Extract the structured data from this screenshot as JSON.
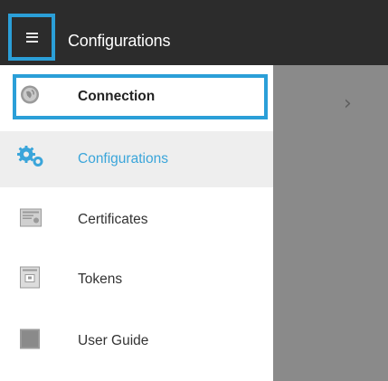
{
  "appbar": {
    "title": "Configurations",
    "menu_icon": "hamburger-menu-icon"
  },
  "drawer": {
    "items": [
      {
        "label": "Connection",
        "icon": "globe-icon",
        "state": "focused"
      },
      {
        "label": "Configurations",
        "icon": "gears-icon",
        "state": "selected"
      },
      {
        "label": "Certificates",
        "icon": "certificate-icon",
        "state": "normal"
      },
      {
        "label": "Tokens",
        "icon": "token-icon",
        "state": "normal"
      },
      {
        "label": "User Guide",
        "icon": "book-icon",
        "state": "normal"
      }
    ]
  },
  "content": {
    "chevron_icon": "chevron-right-icon",
    "chevron_glyph": "›"
  },
  "colors": {
    "appbar": "#2c2c2c",
    "accent": "#2b9fd8",
    "selected_text": "#3aa5da",
    "selected_bg": "#eeeeee",
    "scrim": "#8a8a8a"
  }
}
